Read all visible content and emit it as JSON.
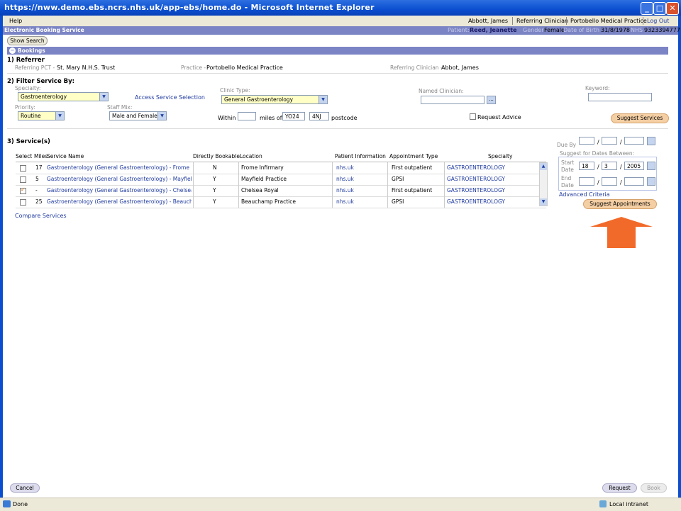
{
  "window": {
    "title": "https://nww.demo.ebs.ncrs.nhs.uk/app-ebs/home.do - Microsoft Internet Explorer",
    "min": "_",
    "max": "□",
    "close": "✕"
  },
  "menu": {
    "help": "Help",
    "user": "Abbott, James",
    "role": "Referring Clinician",
    "practice": "Portobello Medical Practice",
    "logout": "Log Out"
  },
  "ebs_bar": {
    "name": "Electronic Booking Service",
    "patient_label": "Patient:",
    "patient": "Reed, Jeanette",
    "gender_label": "Gender",
    "gender": "Female",
    "dob_label": "Date of Birth",
    "dob": "31/8/1978",
    "nhs_label": "NHS",
    "nhs": "9323394777"
  },
  "show_search": "Show Search",
  "bookings_label": "Bookings",
  "referrer": {
    "heading": "1) Referrer",
    "pct_label": "Referring PCT -",
    "pct": "St. Mary N.H.S. Trust",
    "practice_label": "Practice -",
    "practice": "Portobello Medical Practice",
    "clinician_label": "Referring Clinician -",
    "clinician": "Abbot, James"
  },
  "filter": {
    "heading": "2) Filter Service By:",
    "specialty_label": "Specialty:",
    "specialty": "Gastroenterology",
    "access_link": "Access Service Selection",
    "clinic_type_label": "Clinic Type:",
    "clinic_type": "General Gastroenterology",
    "named_clinician_label": "Named Clinician:",
    "named_clinician_btn": "...",
    "keyword_label": "Keyword:",
    "priority_label": "Priority:",
    "priority": "Routine",
    "staff_mix_label": "Staff Mix:",
    "staff_mix": "Male and Female",
    "within_label": "Within",
    "miles_of_label": "miles of",
    "postcode1": "YO24",
    "postcode2": "4NJ",
    "postcode_label": "postcode",
    "request_advice_label": "Request Advice",
    "suggest_services": "Suggest Services"
  },
  "services": {
    "heading": "3) Service(s)",
    "columns": [
      "Select",
      "Miles",
      "Service Name",
      "Directly Bookable",
      "Location",
      "Patient Information",
      "Appointment Type",
      "Specialty"
    ],
    "rows": [
      {
        "checked": false,
        "miles": "17",
        "name": "Gastroenterology (General Gastroenterology) - Frome Infirmary",
        "bookable": "N",
        "location": "Frome Infirmary",
        "info": "nhs.uk",
        "type": "First outpatient",
        "specialty": "GASTROENTEROLOGY"
      },
      {
        "checked": false,
        "miles": "5",
        "name": "Gastroenterology (General Gastroenterology) - Mayfield Practice",
        "bookable": "Y",
        "location": "Mayfield Practice",
        "info": "nhs.uk",
        "type": "GPSI",
        "specialty": "GASTROENTEROLOGY"
      },
      {
        "checked": true,
        "miles": "-",
        "name": "Gastroenterology (General Gastroenterology) - Chelsea Royal",
        "bookable": "Y",
        "location": "Chelsea Royal",
        "info": "nhs.uk",
        "type": "First outpatient",
        "specialty": "GASTROENTEROLOGY"
      },
      {
        "checked": false,
        "miles": "25",
        "name": "Gastroenterology (General Gastroenterology) - Beauchamp Practice",
        "bookable": "Y",
        "location": "Beauchamp Practice",
        "info": "nhs.uk",
        "type": "GPSI",
        "specialty": "GASTROENTEROLOGY"
      }
    ],
    "compare": "Compare Services"
  },
  "dates": {
    "due_by_label": "Due By",
    "suggest_between_label": "Suggest for Dates Between:",
    "start_label_1": "Start",
    "start_label_2": "Date",
    "start_day": "18",
    "start_month": "3",
    "start_year": "2005",
    "end_label_1": "End",
    "end_label_2": "Date",
    "slash": "/",
    "advanced": "Advanced Criteria",
    "suggest_appointments": "Suggest Appointments"
  },
  "footer": {
    "cancel": "Cancel",
    "request": "Request",
    "book": "Book"
  },
  "status": {
    "done": "Done",
    "zone": "Local intranet"
  },
  "colors": {
    "accent_bar": "#7b84c4",
    "title_bar": "#0b4fd0",
    "arrow": "#f26a2a",
    "button": "#f5cfa4"
  }
}
